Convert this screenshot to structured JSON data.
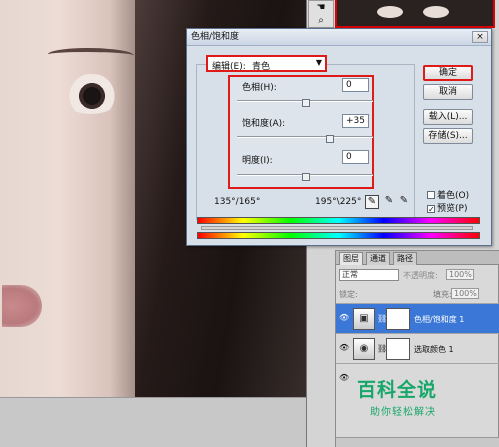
{
  "dialog": {
    "title": "色相/饱和度",
    "close": "×",
    "edit_label": "编辑(E):",
    "edit_value": "青色",
    "hue": {
      "label": "色相(H):",
      "value": "0",
      "slider_fraction": 0.5
    },
    "saturation": {
      "label": "饱和度(A):",
      "value": "+35",
      "slider_fraction": 0.68
    },
    "lightness": {
      "label": "明度(I):",
      "value": "0",
      "slider_fraction": 0.5
    },
    "buttons": {
      "ok": "确定",
      "cancel": "取消",
      "load": "载入(L)...",
      "save": "存储(S)..."
    },
    "colorize_label": "着色(O)",
    "colorize_checked": false,
    "preview_label": "预览(P)",
    "preview_checked": true,
    "range_left": "135°/165°",
    "range_right": "195°\\225°",
    "eyedroppers": [
      "eyedropper-icon",
      "eyedropper-plus-icon",
      "eyedropper-minus-icon"
    ]
  },
  "layers": {
    "tabs": [
      "图层",
      "通道",
      "路径"
    ],
    "blend_mode": "正常",
    "opacity_label": "不透明度:",
    "opacity_value": "100%",
    "lock_label": "锁定:",
    "fill_label": "填充:",
    "fill_value": "100%",
    "items": [
      {
        "name": "色相/饱和度 1",
        "selected": true
      },
      {
        "name": "选取颜色 1",
        "selected": false
      }
    ]
  },
  "watermark": {
    "title": "百科全说",
    "subtitle": "助你轻松解决"
  }
}
